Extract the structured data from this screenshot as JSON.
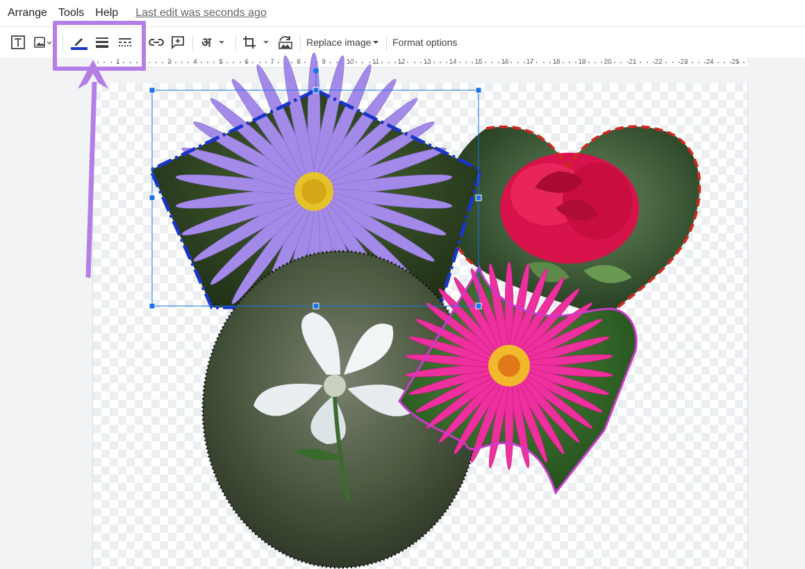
{
  "menu": {
    "items": [
      "Arrange",
      "Tools",
      "Help"
    ],
    "last_edit": "Last edit was seconds ago"
  },
  "toolbar": {
    "replace_image_label": "Replace image",
    "format_options_label": "Format options",
    "icons": [
      "textbox-icon",
      "image-icon",
      "border-color-icon",
      "border-weight-icon",
      "border-dash-icon",
      "link-icon",
      "add-comment-icon",
      "input-tools-icon",
      "crop-icon",
      "reset-image-icon"
    ]
  },
  "ruler": {
    "labels": [
      "1",
      "3",
      "4",
      "5",
      "6",
      "7",
      "8",
      "9",
      "10",
      "11",
      "12",
      "13",
      "14",
      "15",
      "16",
      "17",
      "18",
      "19",
      "20",
      "21",
      "22",
      "23",
      "24",
      "25"
    ]
  },
  "colors": {
    "highlight": "#b57ee6",
    "selection": "#1a73e8",
    "border_blue": "#1a35c8",
    "border_red": "#cc2a1f",
    "border_magenta": "#cc3acc"
  }
}
